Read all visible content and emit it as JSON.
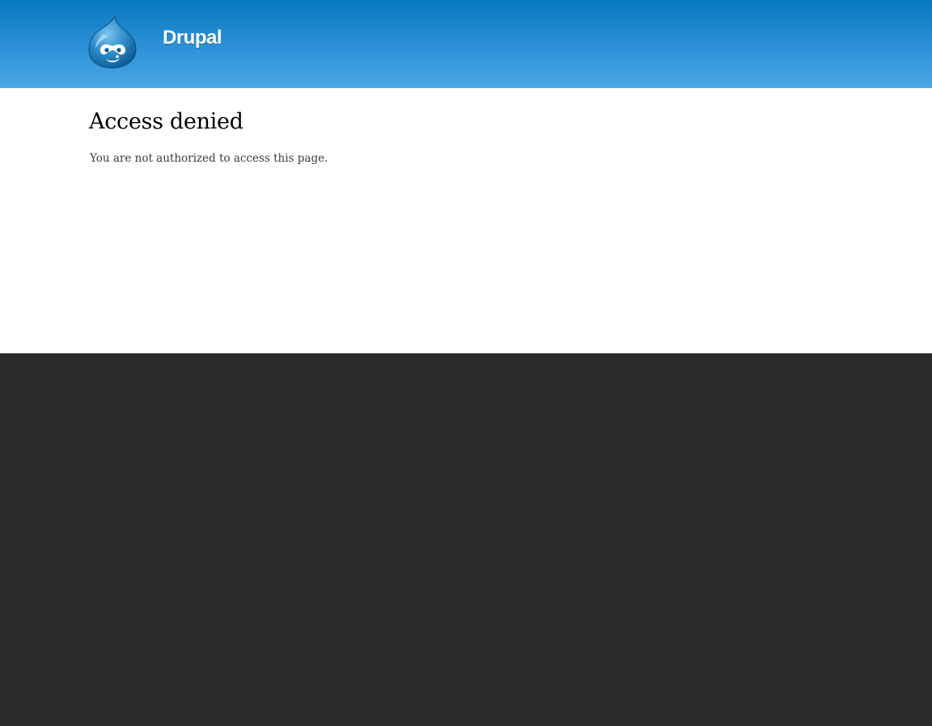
{
  "header": {
    "site_name": "Drupal",
    "logo_icon": "drupal-drop-logo-icon",
    "logo_alt": "Home"
  },
  "main": {
    "title": "Access denied",
    "message": "You are not authorized to access this page."
  },
  "colors": {
    "header_top": "#0779bf",
    "header_bottom": "#4aa8e6",
    "content_bg": "#ffffff",
    "footer_bg": "#2a2a2a",
    "site_name": "#ffffff"
  }
}
